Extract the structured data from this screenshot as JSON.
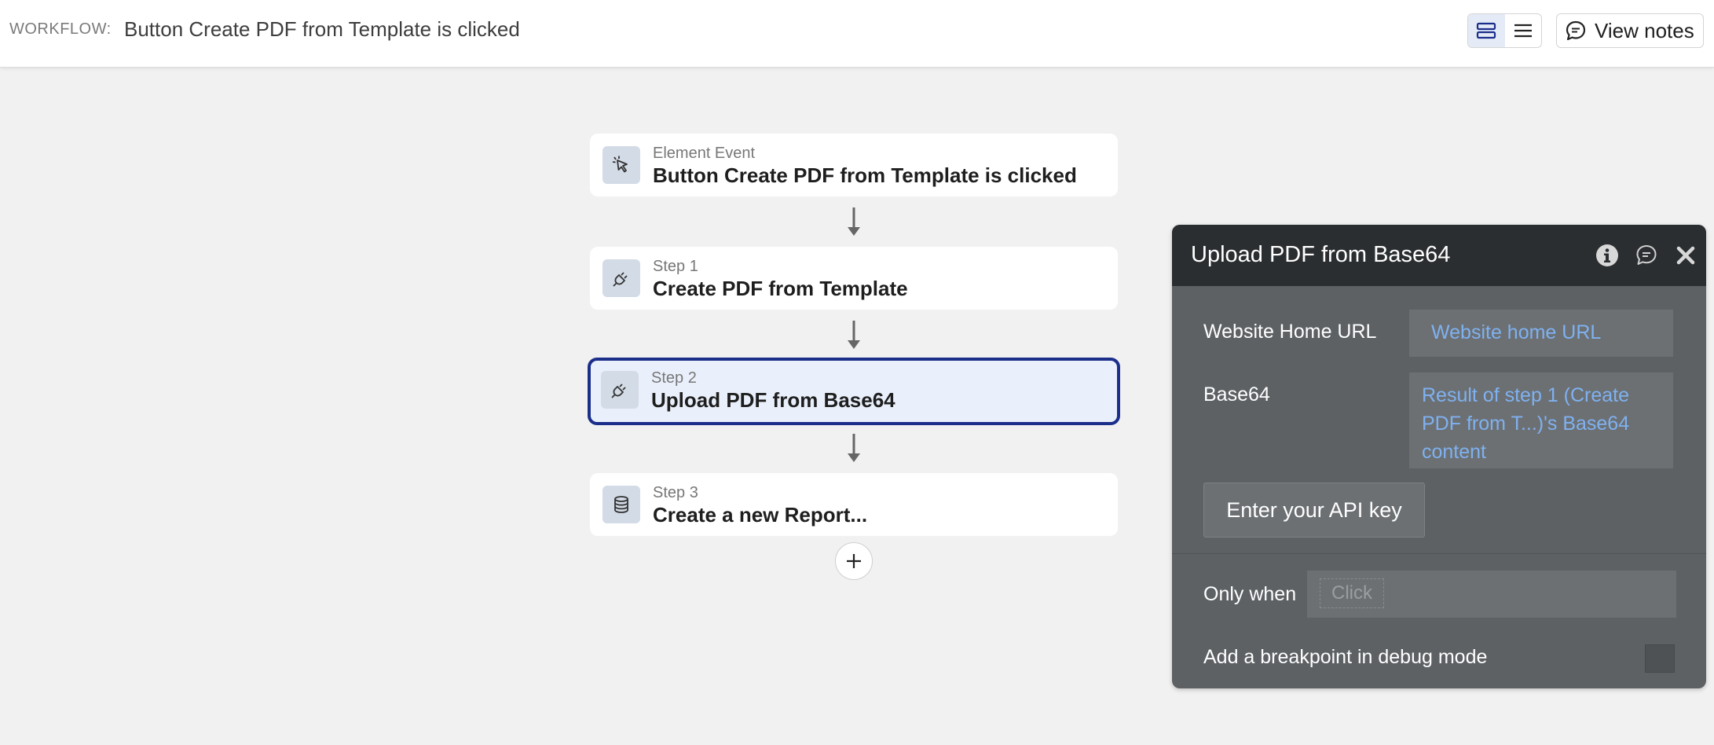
{
  "header": {
    "workflow_label": "WORKFLOW:",
    "workflow_name": "Button Create PDF from Template is clicked",
    "view_notes_label": "View notes"
  },
  "workflow": {
    "steps": [
      {
        "subtitle": "Element Event",
        "title": "Button Create PDF from Template is clicked",
        "icon": "cursor-click-icon"
      },
      {
        "subtitle": "Step 1",
        "title": "Create PDF from Template",
        "icon": "plug-icon"
      },
      {
        "subtitle": "Step 2",
        "title": "Upload PDF from Base64",
        "icon": "plug-icon",
        "selected": true
      },
      {
        "subtitle": "Step 3",
        "title": "Create a new Report...",
        "icon": "database-icon"
      }
    ]
  },
  "panel": {
    "title": "Upload PDF from Base64",
    "fields": [
      {
        "label": "Website Home URL",
        "value": "Website home URL"
      },
      {
        "label": "Base64",
        "value": "Result of step 1 (Create PDF from T...)'s Base64 content"
      }
    ],
    "api_key_button": "Enter your API key",
    "only_when_label": "Only when",
    "only_when_placeholder": "Click",
    "breakpoint_label": "Add a breakpoint in debug mode"
  },
  "colors": {
    "accent": "#1b2e8a",
    "selected_bg": "#eaf0fb",
    "panel_bg": "#5d6164",
    "panel_header": "#2b2e30",
    "link_blue": "#7fb1f0"
  }
}
